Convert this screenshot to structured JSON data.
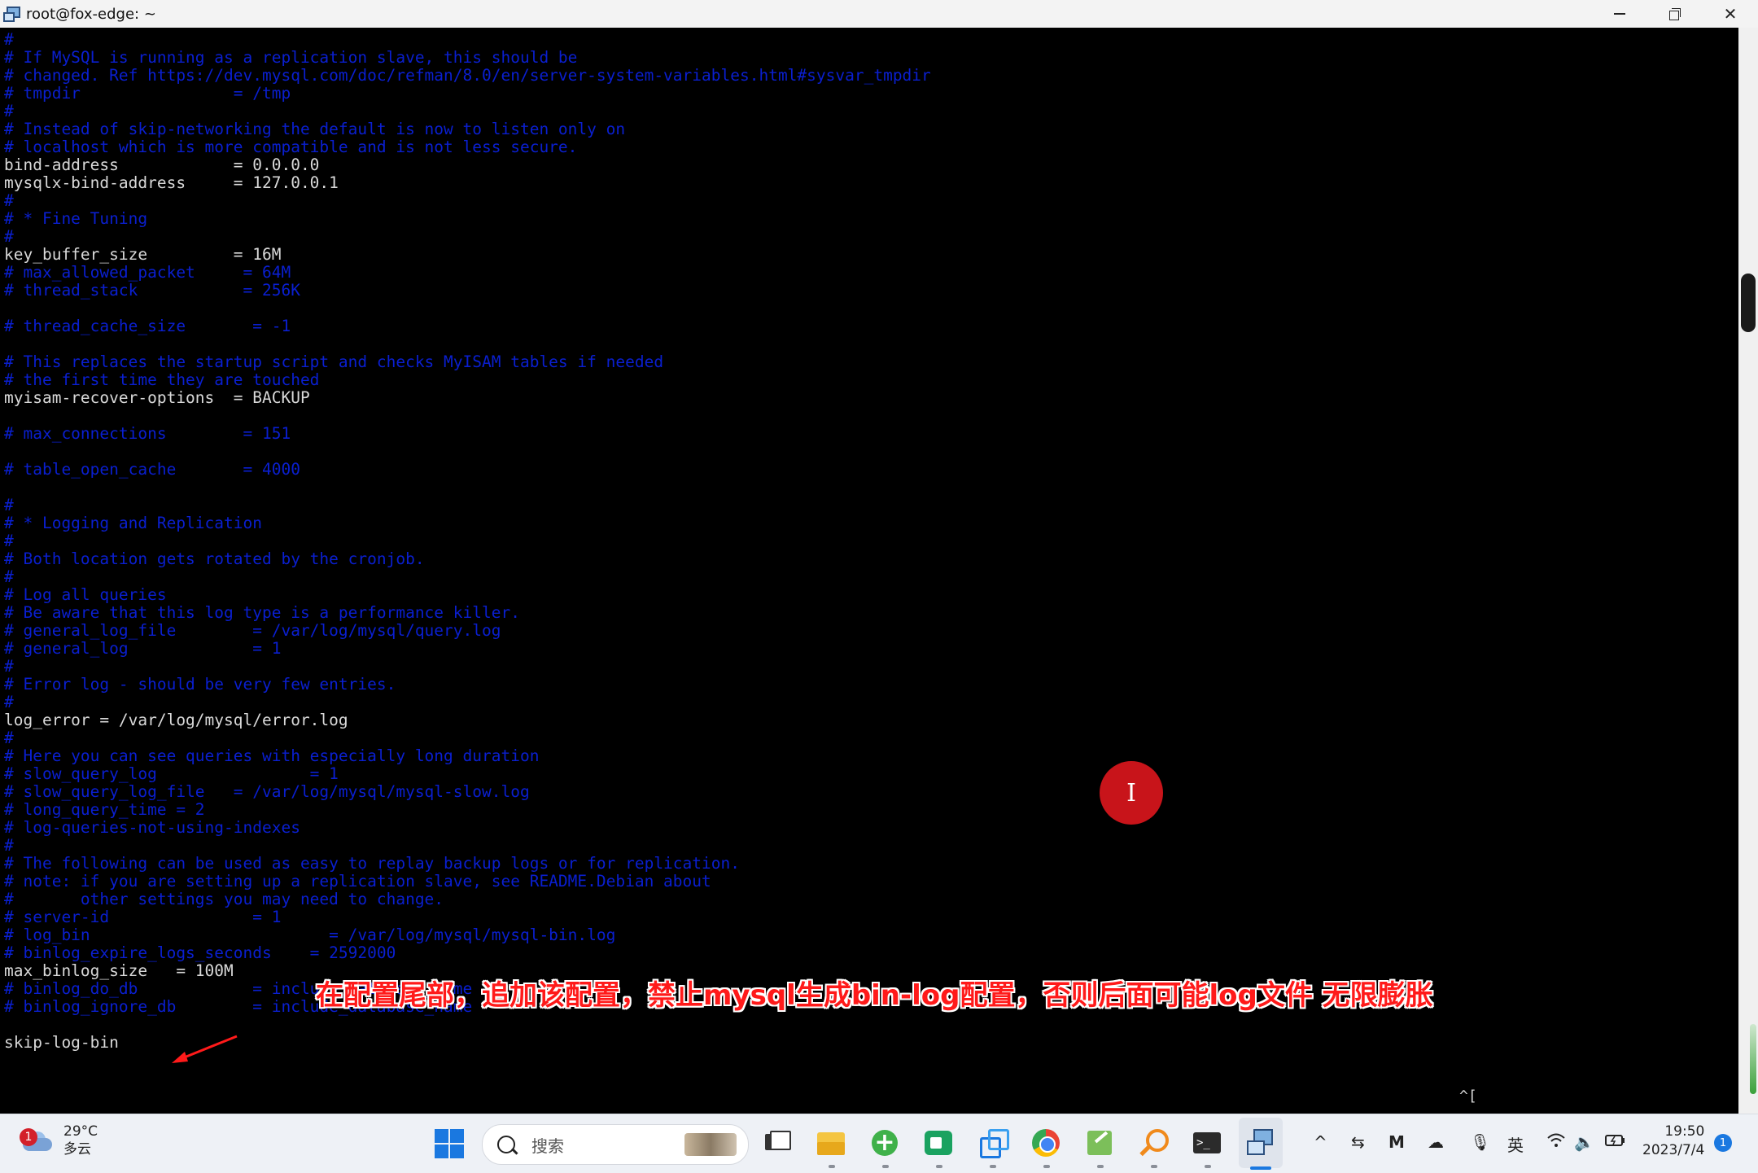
{
  "window": {
    "title": "root@fox-edge: ~"
  },
  "terminal": {
    "lines": [
      {
        "t": "c",
        "text": "#"
      },
      {
        "t": "c",
        "text": "# If MySQL is running as a replication slave, this should be"
      },
      {
        "t": "c",
        "text": "# changed. Ref https://dev.mysql.com/doc/refman/8.0/en/server-system-variables.html#sysvar_tmpdir"
      },
      {
        "t": "c",
        "text": "# tmpdir                = /tmp"
      },
      {
        "t": "c",
        "text": "#"
      },
      {
        "t": "c",
        "text": "# Instead of skip-networking the default is now to listen only on"
      },
      {
        "t": "c",
        "text": "# localhost which is more compatible and is not less secure."
      },
      {
        "t": "n",
        "text": "bind-address            = 0.0.0.0"
      },
      {
        "t": "n",
        "text": "mysqlx-bind-address     = 127.0.0.1"
      },
      {
        "t": "c",
        "text": "#"
      },
      {
        "t": "c",
        "text": "# * Fine Tuning"
      },
      {
        "t": "c",
        "text": "#"
      },
      {
        "t": "n",
        "text": "key_buffer_size         = 16M"
      },
      {
        "t": "c",
        "text": "# max_allowed_packet     = 64M"
      },
      {
        "t": "c",
        "text": "# thread_stack           = 256K"
      },
      {
        "t": "n",
        "text": ""
      },
      {
        "t": "c",
        "text": "# thread_cache_size       = -1"
      },
      {
        "t": "n",
        "text": ""
      },
      {
        "t": "c",
        "text": "# This replaces the startup script and checks MyISAM tables if needed"
      },
      {
        "t": "c",
        "text": "# the first time they are touched"
      },
      {
        "t": "n",
        "text": "myisam-recover-options  = BACKUP"
      },
      {
        "t": "n",
        "text": ""
      },
      {
        "t": "c",
        "text": "# max_connections        = 151"
      },
      {
        "t": "n",
        "text": ""
      },
      {
        "t": "c",
        "text": "# table_open_cache       = 4000"
      },
      {
        "t": "n",
        "text": ""
      },
      {
        "t": "c",
        "text": "#"
      },
      {
        "t": "c",
        "text": "# * Logging and Replication"
      },
      {
        "t": "c",
        "text": "#"
      },
      {
        "t": "c",
        "text": "# Both location gets rotated by the cronjob."
      },
      {
        "t": "c",
        "text": "#"
      },
      {
        "t": "c",
        "text": "# Log all queries"
      },
      {
        "t": "c",
        "text": "# Be aware that this log type is a performance killer."
      },
      {
        "t": "c",
        "text": "# general_log_file        = /var/log/mysql/query.log"
      },
      {
        "t": "c",
        "text": "# general_log             = 1"
      },
      {
        "t": "c",
        "text": "#"
      },
      {
        "t": "c",
        "text": "# Error log - should be very few entries."
      },
      {
        "t": "c",
        "text": "#"
      },
      {
        "t": "n",
        "text": "log_error = /var/log/mysql/error.log"
      },
      {
        "t": "c",
        "text": "#"
      },
      {
        "t": "c",
        "text": "# Here you can see queries with especially long duration"
      },
      {
        "t": "c",
        "text": "# slow_query_log                = 1"
      },
      {
        "t": "c",
        "text": "# slow_query_log_file   = /var/log/mysql/mysql-slow.log"
      },
      {
        "t": "c",
        "text": "# long_query_time = 2"
      },
      {
        "t": "c",
        "text": "# log-queries-not-using-indexes"
      },
      {
        "t": "c",
        "text": "#"
      },
      {
        "t": "c",
        "text": "# The following can be used as easy to replay backup logs or for replication."
      },
      {
        "t": "c",
        "text": "# note: if you are setting up a replication slave, see README.Debian about"
      },
      {
        "t": "c",
        "text": "#       other settings you may need to change."
      },
      {
        "t": "c",
        "text": "# server-id               = 1"
      },
      {
        "t": "c",
        "text": "# log_bin                         = /var/log/mysql/mysql-bin.log"
      },
      {
        "t": "c",
        "text": "# binlog_expire_logs_seconds    = 2592000"
      },
      {
        "t": "n",
        "text": "max_binlog_size   = 100M"
      },
      {
        "t": "c",
        "text": "# binlog_do_db            = include_database_name"
      },
      {
        "t": "c",
        "text": "# binlog_ignore_db        = include_database_name"
      },
      {
        "t": "n",
        "text": ""
      },
      {
        "t": "n",
        "text": "skip-log-bin"
      }
    ],
    "status_mark": "^[",
    "cursor_glyph": "I"
  },
  "annotation": {
    "caption": "在配置尾部，追加该配置，禁止mysql生成bin-log配置，否则后面可能log文件 无限膨胀",
    "color": "#ff1a1a"
  },
  "taskbar": {
    "weather_badge": "1",
    "temperature": "29°C",
    "weather": "多云",
    "search_placeholder": "搜索",
    "ime": "英",
    "time": "19:50",
    "date": "2023/7/4",
    "notification_count": "1",
    "accent": "#1a78e0"
  },
  "icons": [
    "shell-window-icon",
    "minimize-icon",
    "restore-icon",
    "close-icon",
    "weather-cloud-icon",
    "windows-start-icon",
    "search-icon",
    "task-view-icon",
    "file-explorer-icon",
    "add-app-icon",
    "meet-icon",
    "remote-desktop-icon",
    "chrome-icon",
    "editor-icon",
    "search-tool-icon",
    "terminal-icon",
    "putty-icon",
    "chevron-up-icon",
    "settings-sliders-icon",
    "mail-icon",
    "cloud-icon",
    "microphone-icon",
    "wifi-icon",
    "volume-icon",
    "battery-icon"
  ]
}
